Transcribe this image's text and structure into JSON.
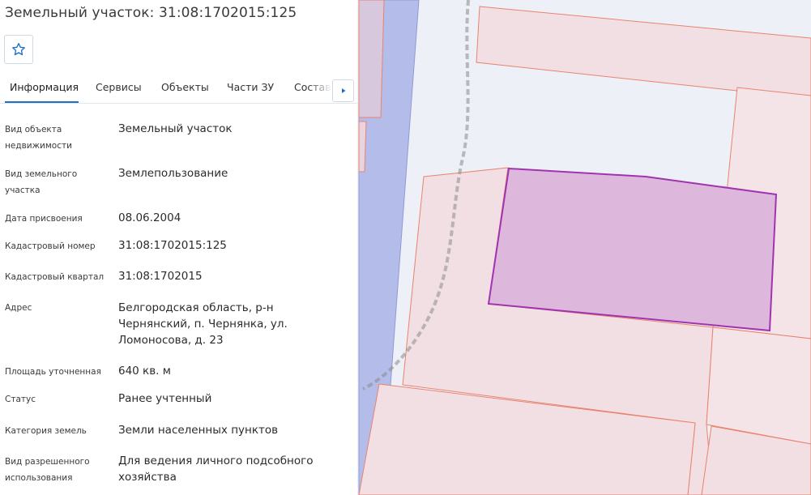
{
  "title": "Земельный участок: 31:08:1702015:125",
  "tabs": [
    {
      "label": "Информация"
    },
    {
      "label": "Сервисы"
    },
    {
      "label": "Объекты"
    },
    {
      "label": "Части ЗУ"
    },
    {
      "label": "Состав"
    }
  ],
  "fields": [
    {
      "label": "Вид объекта недвижимости",
      "value": "Земельный участок"
    },
    {
      "label": "Вид земельного участка",
      "value": "Землепользование"
    },
    {
      "label": "Дата присвоения",
      "value": "08.06.2004"
    },
    {
      "label": "Кадастровый номер",
      "value": "31:08:1702015:125"
    },
    {
      "label": "Кадастровый квартал",
      "value": "31:08:1702015"
    },
    {
      "label": "Адрес",
      "value": "Белгородская область, р-н Чернянский, п. Чернянка, ул. Ломоносова, д. 23"
    },
    {
      "label": "Площадь уточненная",
      "value": "640 кв. м"
    },
    {
      "label": "Статус",
      "value": "Ранее учтенный"
    },
    {
      "label": "Категория земель",
      "value": "Земли населенных пунктов"
    },
    {
      "label": "Вид разрешенного использования",
      "value": "Для ведения личного подсобного хозяйства"
    }
  ],
  "icons": {
    "favorite": "star-outline-icon",
    "next": "triangle-right-icon"
  },
  "colors": {
    "accent": "#1f6fc7",
    "parcel_fill": "#f2dfe3",
    "parcel_border": "#e8836f",
    "selected_fill": "#ddb8dc",
    "selected_border": "#a233b0",
    "road": "#b4bde9"
  }
}
